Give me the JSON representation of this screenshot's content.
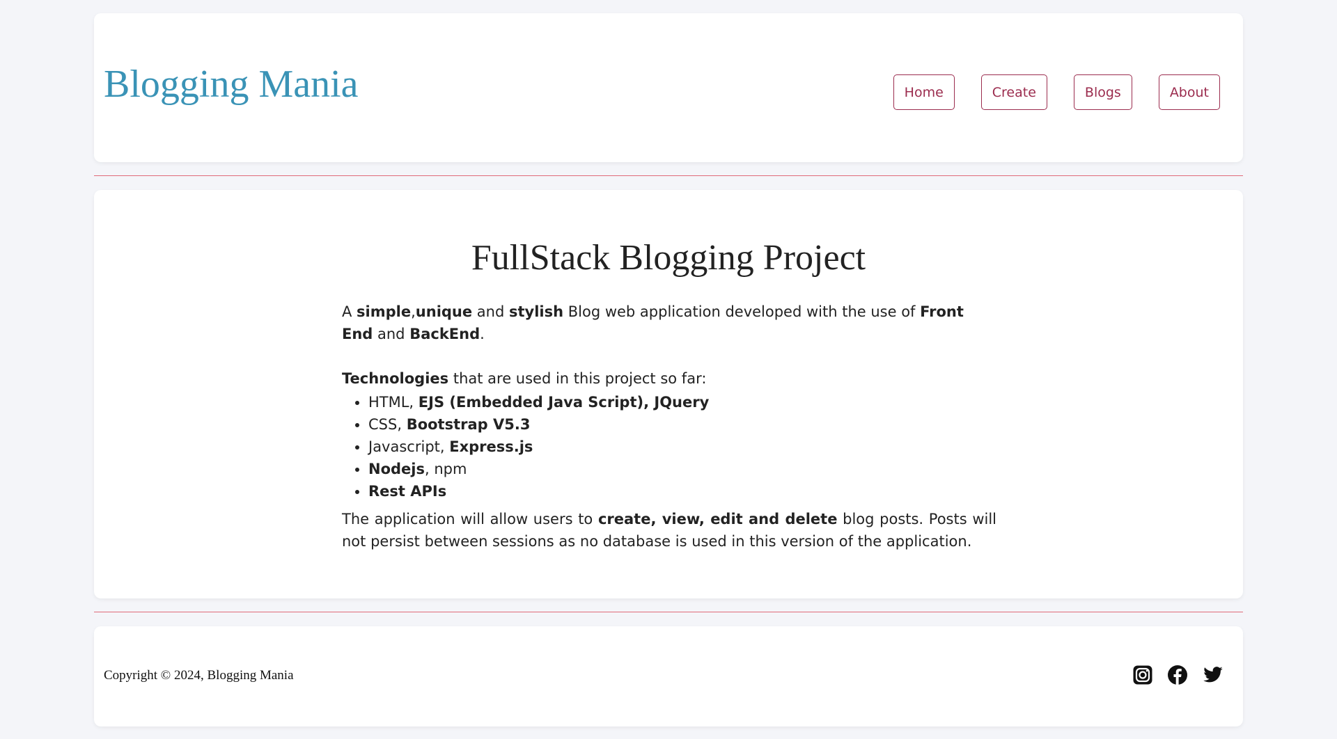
{
  "header": {
    "brand": "Blogging Mania",
    "nav": [
      "Home",
      "Create",
      "Blogs",
      "About"
    ]
  },
  "main": {
    "title": "FullStack Blogging Project",
    "intro": {
      "p1": "A ",
      "b1": "simple",
      "p2": ",",
      "b2": "unique",
      "p3": " and ",
      "b3": "stylish",
      "p4": " Blog web application developed with the use of ",
      "b4": "Front End",
      "p5": " and ",
      "b5": "BackEnd",
      "p6": "."
    },
    "tech": {
      "b1": "Technologies",
      "p1": " that are used in this project so far:"
    },
    "tech_list": [
      {
        "plain": "HTML, ",
        "bold": "EJS (Embedded Java Script), JQuery",
        "after": ""
      },
      {
        "plain": "CSS, ",
        "bold": "Bootstrap V5.3",
        "after": ""
      },
      {
        "plain": "Javascript, ",
        "bold": "Express.js",
        "after": ""
      },
      {
        "plain": "",
        "bold": "Nodejs",
        "after": ", npm"
      },
      {
        "plain": "",
        "bold": "Rest APIs",
        "after": ""
      }
    ],
    "outro": {
      "p1": "The application will allow users to ",
      "b1": "create, view, edit and delete",
      "p2": " blog posts. Posts will not persist between sessions as no database is used in this version of the application."
    }
  },
  "footer": {
    "copyright": "Copyright © 2024, Blogging Mania",
    "social_icons": [
      "instagram-icon",
      "facebook-icon",
      "twitter-icon"
    ]
  },
  "colors": {
    "brand": "#3a93b6",
    "nav_accent": "#9b2c4e",
    "divider": "#e06a78",
    "background": "#f4f5f9"
  }
}
